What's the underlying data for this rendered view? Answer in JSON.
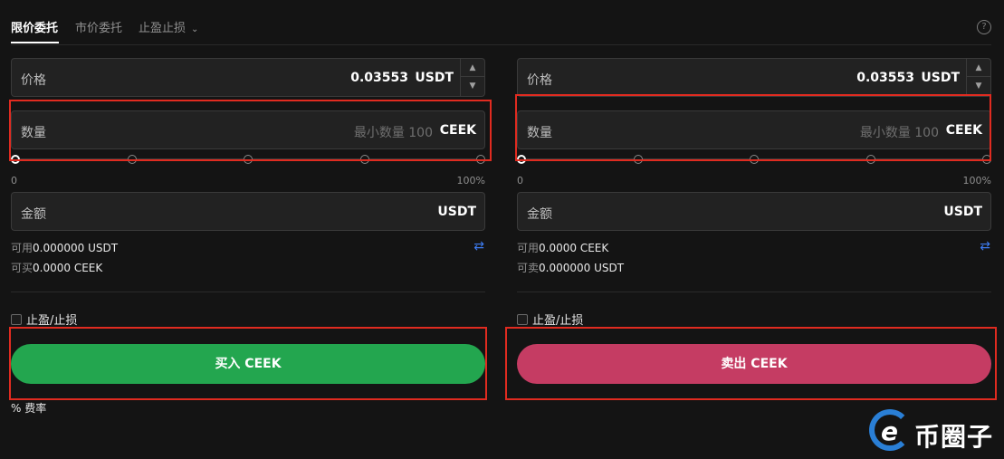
{
  "tabs": [
    {
      "label": "限价委托",
      "active": true
    },
    {
      "label": "市价委托",
      "active": false
    },
    {
      "label": "止盈止损",
      "active": false
    }
  ],
  "help_icon": "?",
  "buy": {
    "price_label": "价格",
    "price_value": "0.03553",
    "price_unit": "USDT",
    "qty_label": "数量",
    "qty_placeholder": "最小数量 100",
    "qty_unit": "CEEK",
    "slider_min": "0",
    "slider_max": "100%",
    "amount_label": "金额",
    "amount_unit": "USDT",
    "avail_label": "可用",
    "avail_value": "0.000000 USDT",
    "can_label": "可买",
    "can_value": "0.0000 CEEK",
    "tpsl_label": "止盈/止损",
    "action_label": "买入 CEEK",
    "fee_label": "费率",
    "fee_icon": "%"
  },
  "sell": {
    "price_label": "价格",
    "price_value": "0.03553",
    "price_unit": "USDT",
    "qty_label": "数量",
    "qty_placeholder": "最小数量 100",
    "qty_unit": "CEEK",
    "slider_min": "0",
    "slider_max": "100%",
    "amount_label": "金额",
    "amount_unit": "USDT",
    "avail_label": "可用",
    "avail_value": "0.0000 CEEK",
    "can_label": "可卖",
    "can_value": "0.000000 USDT",
    "tpsl_label": "止盈/止损",
    "action_label": "卖出 CEEK"
  },
  "stepper": {
    "up": "▲",
    "down": "▼"
  },
  "swap_icon": "⇄",
  "watermark": {
    "mark": "e",
    "text": "币圈子"
  },
  "colors": {
    "buy": "#23a64f",
    "sell": "#c53c63",
    "highlight": "#e02b20",
    "link": "#3d7bf0"
  }
}
